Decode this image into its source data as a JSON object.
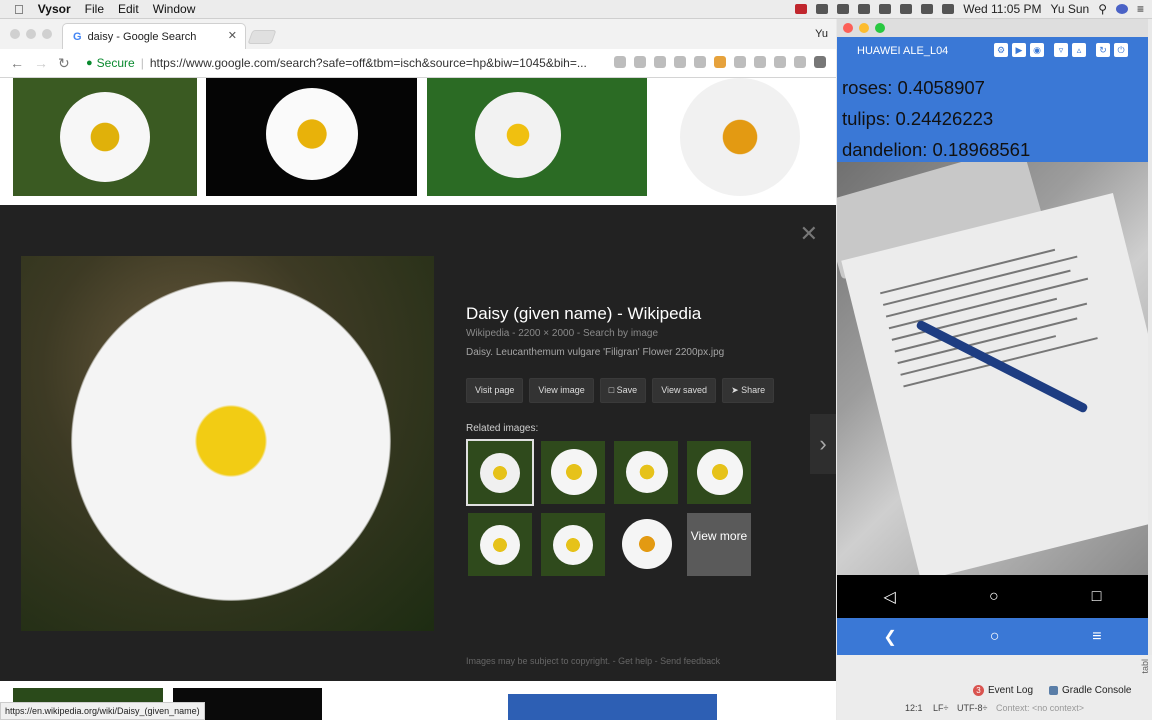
{
  "menubar": {
    "app": "Vysor",
    "items": [
      "File",
      "Edit",
      "Window"
    ],
    "clock": "Wed 11:05 PM",
    "user": "Yu Sun"
  },
  "browser": {
    "tab_title": "daisy - Google Search",
    "profile": "Yu",
    "secure_label": "Secure",
    "url": "https://www.google.com/search?safe=off&tbm=isch&source=hp&biw=1045&bih=..."
  },
  "image_panel": {
    "title": "Daisy (given name) - Wikipedia",
    "meta": "Wikipedia  -  2200 × 2000  -  Search by image",
    "description": "Daisy. Leucanthemum vulgare 'Filigran' Flower 2200px.jpg",
    "buttons": [
      "Visit page",
      "View image",
      "Save",
      "View saved",
      "Share"
    ],
    "related_label": "Related images:",
    "view_more": "View more",
    "copyright": "Images may be subject to copyright.  -  Get help  -  Send feedback"
  },
  "status_url": "https://en.wikipedia.org/wiki/Daisy_(given_name)",
  "vysor": {
    "device": "HUAWEI ALE_L04",
    "predictions": [
      {
        "label": "roses: 0.4058907"
      },
      {
        "label": "tulips: 0.24426223"
      },
      {
        "label": "dandelion: 0.18968561"
      }
    ]
  },
  "ide": {
    "event_log": "Event Log",
    "event_count": "3",
    "gradle": "Gradle Console",
    "status_pos": "12:1",
    "status_lf": "LF÷",
    "status_enc": "UTF-8÷",
    "status_ctx": "Context: <no context>",
    "side_label": "tabl"
  },
  "colors": {
    "vysor_blue": "#3a78d6",
    "panel_bg": "#222222",
    "secure_green": "#0a8a2f"
  }
}
